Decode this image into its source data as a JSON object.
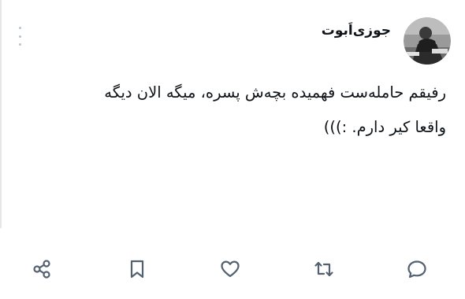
{
  "tweet": {
    "author": {
      "display_name": "جوزی‌اَبوت",
      "avatar_icon": "avatar-photo"
    },
    "text_lines": [
      "رفیقم حامله‌ست فهمیده بچه‌ش پسره، میگه الان دیگه",
      "واقعا کیر دارم. :)))"
    ],
    "actions": {
      "reply_icon": "reply-icon",
      "retweet_icon": "retweet-icon",
      "like_icon": "heart-icon",
      "bookmark_icon": "bookmark-icon",
      "share_icon": "share-icon"
    },
    "menu_icon": "more-dots-icon"
  },
  "colors": {
    "text": "#0f1419",
    "icon": "#53606e",
    "muted": "#b9c4cc"
  }
}
